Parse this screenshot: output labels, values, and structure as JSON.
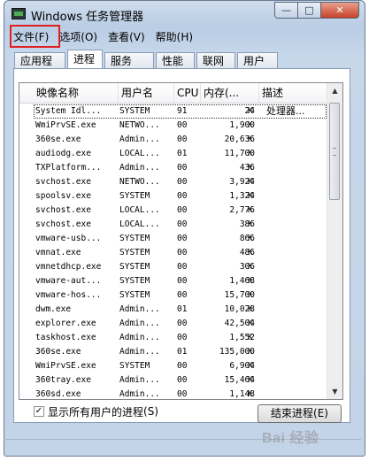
{
  "window": {
    "title": "Windows 任务管理器"
  },
  "caption_buttons": {
    "minimize": "—",
    "maximize": "□",
    "close": "✕"
  },
  "menu": [
    {
      "label": "文件(F)"
    },
    {
      "label": "选项(O)"
    },
    {
      "label": "查看(V)"
    },
    {
      "label": "帮助(H)"
    }
  ],
  "tabs": [
    {
      "label": "应用程序"
    },
    {
      "label": "进程"
    },
    {
      "label": "服务"
    },
    {
      "label": "性能"
    },
    {
      "label": "联网"
    },
    {
      "label": "用户"
    }
  ],
  "active_tab": "进程",
  "columns": [
    "映像名称",
    "用户名",
    "CPU",
    "内存(...",
    "描述"
  ],
  "processes": [
    {
      "name": "System Idl...",
      "user": "SYSTEM",
      "cpu": "91",
      "mem": "24",
      "unit": "K",
      "desc": "处理器..."
    },
    {
      "name": "WmiPrvSE.exe",
      "user": "NETWO...",
      "cpu": "00",
      "mem": "1,900",
      "unit": "K",
      "desc": ""
    },
    {
      "name": "360se.exe",
      "user": "Admin...",
      "cpu": "00",
      "mem": "20,636",
      "unit": "K",
      "desc": ""
    },
    {
      "name": "audiodg.exe",
      "user": "LOCAL...",
      "cpu": "01",
      "mem": "11,700",
      "unit": "K",
      "desc": ""
    },
    {
      "name": "TXPlatform...",
      "user": "Admin...",
      "cpu": "00",
      "mem": "436",
      "unit": "K",
      "desc": ""
    },
    {
      "name": "svchost.exe",
      "user": "NETWO...",
      "cpu": "00",
      "mem": "3,924",
      "unit": "K",
      "desc": ""
    },
    {
      "name": "spoolsv.exe",
      "user": "SYSTEM",
      "cpu": "00",
      "mem": "1,324",
      "unit": "K",
      "desc": ""
    },
    {
      "name": "svchost.exe",
      "user": "LOCAL...",
      "cpu": "00",
      "mem": "2,776",
      "unit": "K",
      "desc": ""
    },
    {
      "name": "svchost.exe",
      "user": "LOCAL...",
      "cpu": "00",
      "mem": "386",
      "unit": "K",
      "desc": ""
    },
    {
      "name": "vmware-usb...",
      "user": "SYSTEM",
      "cpu": "00",
      "mem": "866",
      "unit": "K",
      "desc": ""
    },
    {
      "name": "vmnat.exe",
      "user": "SYSTEM",
      "cpu": "00",
      "mem": "486",
      "unit": "K",
      "desc": ""
    },
    {
      "name": "vmnetdhcp.exe",
      "user": "SYSTEM",
      "cpu": "00",
      "mem": "306",
      "unit": "K",
      "desc": ""
    },
    {
      "name": "vmware-aut...",
      "user": "SYSTEM",
      "cpu": "00",
      "mem": "1,468",
      "unit": "K",
      "desc": ""
    },
    {
      "name": "vmware-hos...",
      "user": "SYSTEM",
      "cpu": "00",
      "mem": "15,700",
      "unit": "K",
      "desc": ""
    },
    {
      "name": "dwm.exe",
      "user": "Admin...",
      "cpu": "01",
      "mem": "10,028",
      "unit": "K",
      "desc": ""
    },
    {
      "name": "explorer.exe",
      "user": "Admin...",
      "cpu": "00",
      "mem": "42,504",
      "unit": "K",
      "desc": ""
    },
    {
      "name": "taskhost.exe",
      "user": "Admin...",
      "cpu": "00",
      "mem": "1,552",
      "unit": "K",
      "desc": ""
    },
    {
      "name": "360se.exe",
      "user": "Admin...",
      "cpu": "01",
      "mem": "135,000",
      "unit": "K",
      "desc": ""
    },
    {
      "name": "WmiPrvSE.exe",
      "user": "SYSTEM",
      "cpu": "00",
      "mem": "6,904",
      "unit": "K",
      "desc": ""
    },
    {
      "name": "360tray.exe",
      "user": "Admin...",
      "cpu": "00",
      "mem": "15,464",
      "unit": "K",
      "desc": ""
    },
    {
      "name": "360sd.exe",
      "user": "Admin...",
      "cpu": "00",
      "mem": "1,148",
      "unit": "K",
      "desc": ""
    }
  ],
  "show_all_users": {
    "label": "显示所有用户的进程",
    "shortcut": "(S)",
    "checked": true
  },
  "end_process_button": "结束进程(E)",
  "watermark": "Bai 经验",
  "colors": {
    "highlight_box": "#e02020",
    "title_gradient": "#b9cde4"
  },
  "icons": {
    "app": "task-manager-icon",
    "scroll_up": "up-arrow-icon",
    "scroll_down": "down-arrow-icon",
    "check": "checkmark-icon"
  }
}
